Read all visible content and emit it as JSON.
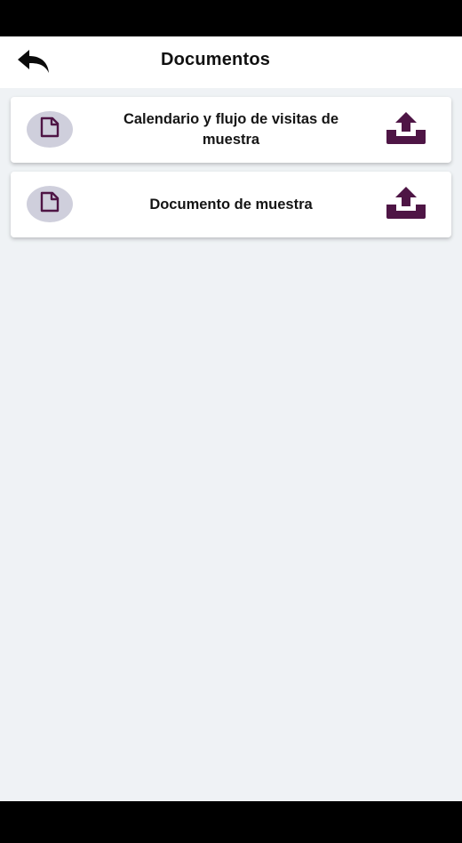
{
  "header": {
    "title": "Documentos",
    "back_icon": "back-arrow-icon"
  },
  "documents": [
    {
      "title": "Calendario y flujo de visitas de muestra",
      "icon": "document-icon",
      "action_icon": "upload-icon"
    },
    {
      "title": "Documento de muestra",
      "icon": "document-icon",
      "action_icon": "upload-icon"
    }
  ],
  "colors": {
    "accent": "#4e1545",
    "icon_circle": "#cfcfdc",
    "background": "#eff2f5",
    "header": "#ffffff"
  }
}
